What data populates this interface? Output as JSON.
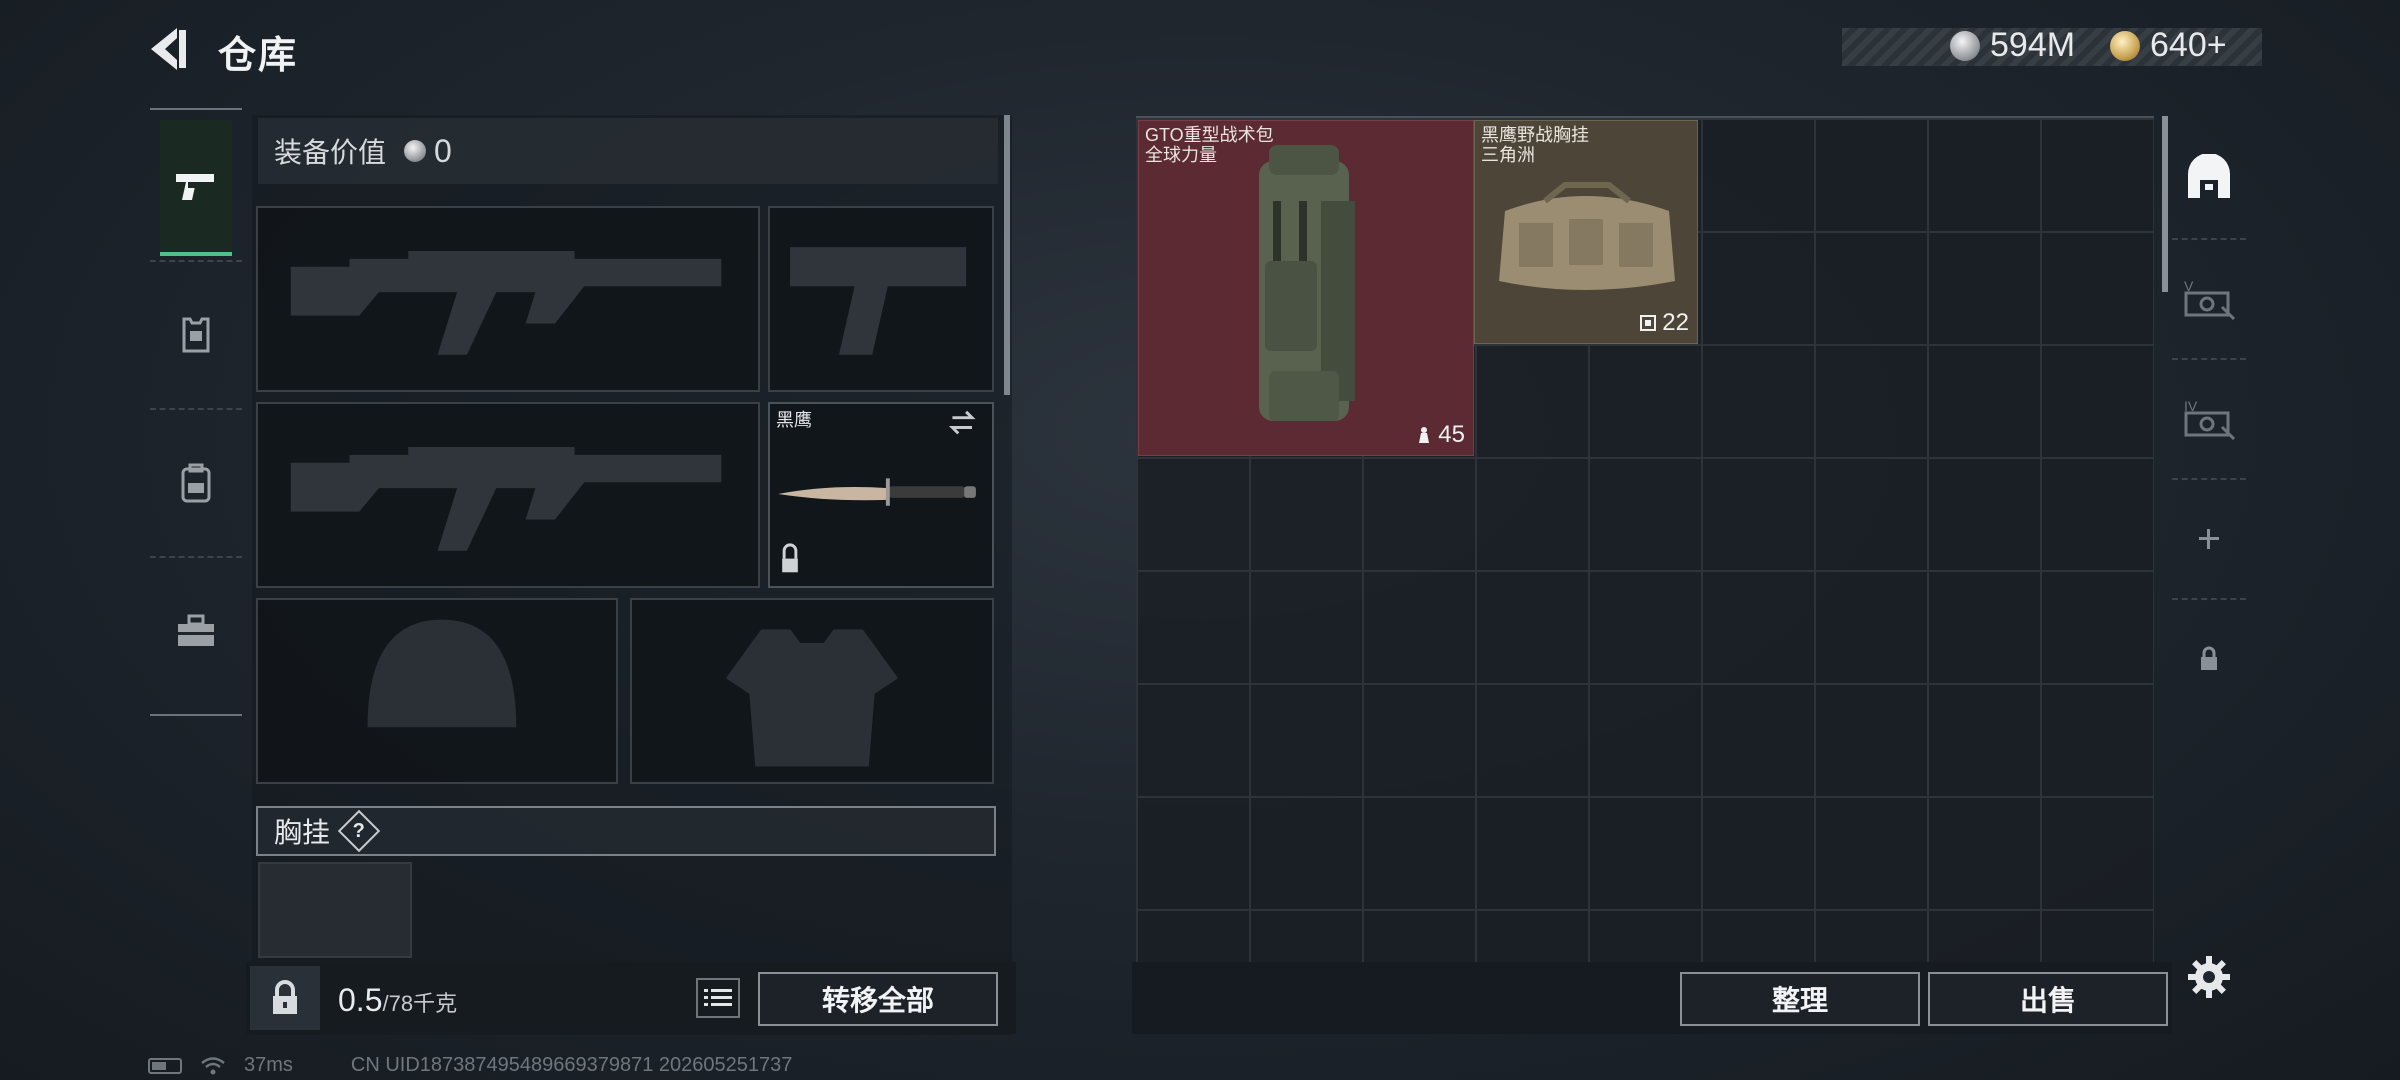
{
  "header": {
    "title": "仓库"
  },
  "currency": {
    "silver": "594M",
    "gold": "640+"
  },
  "equipment": {
    "value_label": "装备价值",
    "value": "0",
    "melee_name": "黑鹰",
    "chest_label": "胸挂",
    "help": "?"
  },
  "left_tabs": [
    "weapons",
    "armor",
    "backpack",
    "toolbox"
  ],
  "capacity": {
    "value": "0.5",
    "max": "/78千克"
  },
  "buttons": {
    "transfer_all": "转移全部",
    "sort": "整理",
    "sell": "出售"
  },
  "stash_items": [
    {
      "name_line1": "GTO重型战术包",
      "name_line2": "全球力量",
      "count": "45",
      "count_icon": "weight-icon"
    },
    {
      "name_line1": "黑鹰野战胸挂",
      "name_line2": "三角洲",
      "count": "22",
      "count_icon": "capacity-icon"
    }
  ],
  "right_tabs": [
    "warehouse",
    "expansion-v",
    "expansion-iv",
    "add",
    "locked"
  ],
  "status": {
    "ping": "37ms",
    "uid": "CN UID187387495489669379871 202605251737"
  },
  "colors": {
    "accent_green": "#4fc08a",
    "backpack_bg": "#5b2a32",
    "vest_bg": "#4d4538"
  }
}
